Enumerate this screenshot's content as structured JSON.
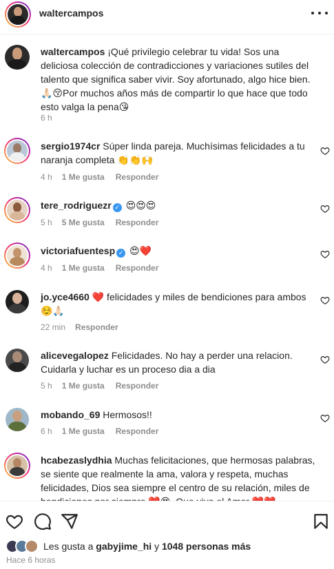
{
  "header": {
    "username": "waltercampos"
  },
  "caption": {
    "username": "waltercampos",
    "text": "¡Qué privilegio celebrar tu vida! Sos una deliciosa colección de contradicciones y variaciones sutiles del talento que significa saber vivir. Soy afortunado, algo hice bien. 🙏🏻😚Por muchos años más de compartir lo que hace que todo esto valga la pena😘",
    "time": "6 h"
  },
  "comments": [
    {
      "username": "sergio1974cr",
      "verified": false,
      "text": "Súper linda pareja. Muchísimas felicidades a tu naranja completa 👏👏🙌",
      "time": "4 h",
      "likes": "1 Me gusta",
      "reply": "Responder"
    },
    {
      "username": "tere_rodriguezr",
      "verified": true,
      "text": "😍😍😍",
      "time": "5 h",
      "likes": "5 Me gusta",
      "reply": "Responder"
    },
    {
      "username": "victoriafuentesp",
      "verified": true,
      "text": "😍❤️",
      "time": "4 h",
      "likes": "1 Me gusta",
      "reply": "Responder"
    },
    {
      "username": "jo.yce4660",
      "verified": false,
      "text": "❤️ felicidades y miles de bendiciones para ambos ☺️🙏🏻",
      "time": "22 min",
      "likes": "",
      "reply": "Responder"
    },
    {
      "username": "alicevegalopez",
      "verified": false,
      "text": "Felicidades. No hay a perder una relacion. Cuidarla y luchar es un proceso dia a dia",
      "time": "5 h",
      "likes": "1 Me gusta",
      "reply": "Responder"
    },
    {
      "username": "mobando_69",
      "verified": false,
      "text": "Hermosos!!",
      "time": "6 h",
      "likes": "1 Me gusta",
      "reply": "Responder"
    },
    {
      "username": "hcabezaslydhia",
      "verified": false,
      "text": "Muchas felicitaciones, que hermosas palabras, se siente que realmente la ama, valora y respeta, muchas felicidades, Dios sea siempre el centro de su relación, miles de bendiciones por siempre ❤️😍. Que viva el Amor ❤️❤️",
      "time": "",
      "likes": "",
      "reply": ""
    }
  ],
  "footer": {
    "likes_prefix": "Les gusta a",
    "likes_user": "gabyjime_hi",
    "likes_connector": "y",
    "likes_others": "1048 personas más",
    "time_ago": "Hace 6 horas"
  },
  "colors": {
    "text": "#262626",
    "muted": "#8e8e8e",
    "verified": "#3897f0",
    "border": "#efefef"
  },
  "icons": [
    "more-options-icon",
    "heart-icon",
    "comment-icon",
    "share-icon",
    "bookmark-icon",
    "verified-badge-icon"
  ]
}
